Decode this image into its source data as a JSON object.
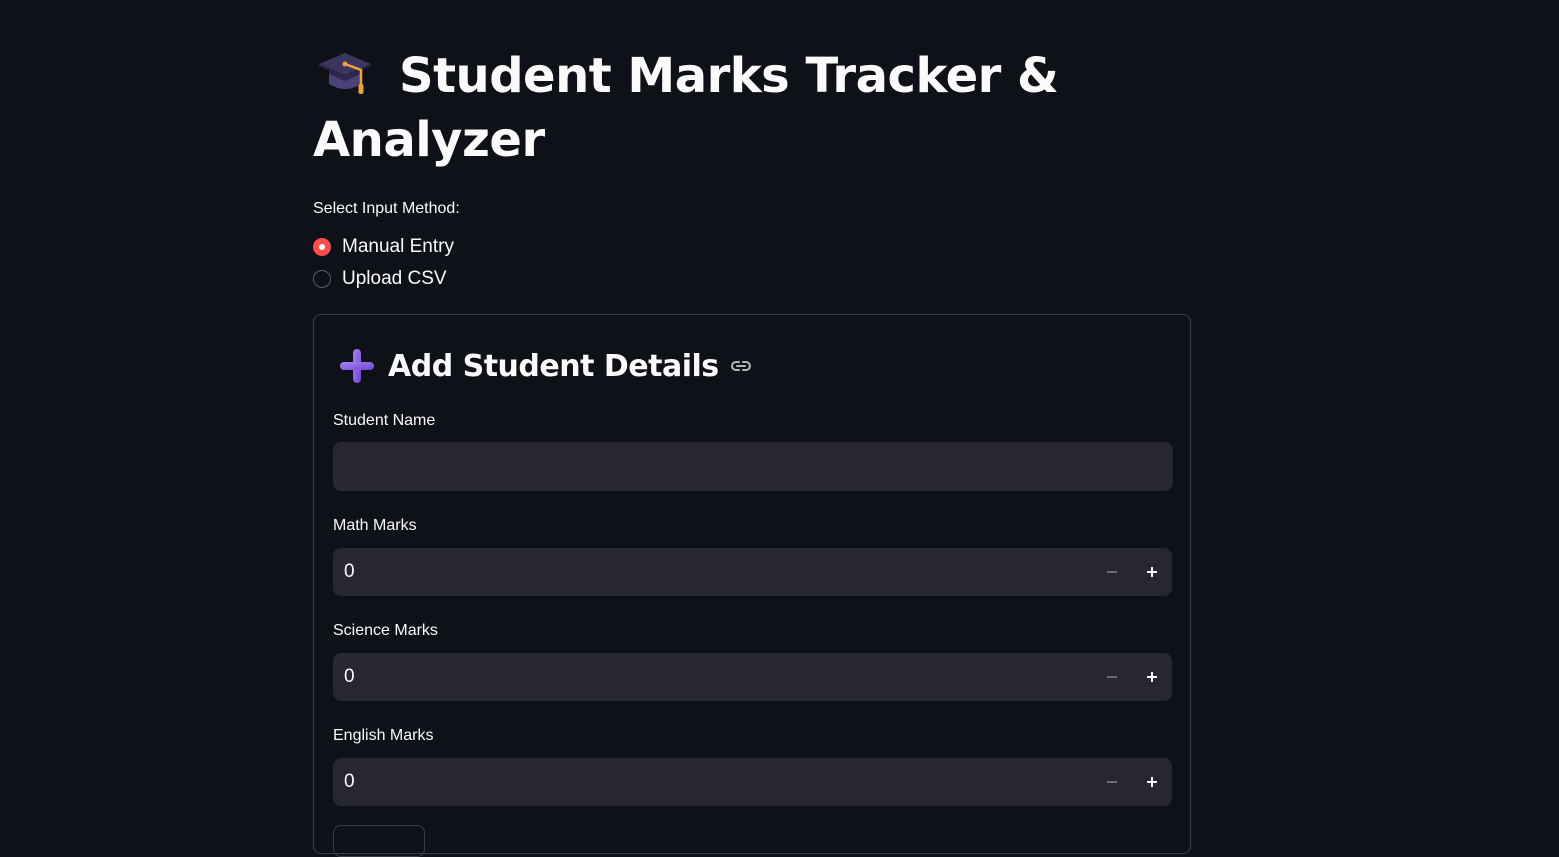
{
  "app": {
    "title": "Student Marks Tracker & Analyzer",
    "title_icon": "graduation-cap-emoji"
  },
  "input_method": {
    "label": "Select Input Method:",
    "options": [
      {
        "label": "Manual Entry",
        "selected": true
      },
      {
        "label": "Upload CSV",
        "selected": false
      }
    ]
  },
  "form": {
    "header_icon": "heavy-plus-emoji",
    "title": "Add Student Details",
    "fields": {
      "name": {
        "label": "Student Name",
        "value": "",
        "placeholder": ""
      },
      "math": {
        "label": "Math Marks",
        "value": "0"
      },
      "science": {
        "label": "Science Marks",
        "value": "0"
      },
      "english": {
        "label": "English Marks",
        "value": "0"
      }
    }
  },
  "colors": {
    "background": "#0e1117",
    "input_bg": "#262730",
    "accent": "#ff4b4b",
    "text": "#fafafa"
  }
}
